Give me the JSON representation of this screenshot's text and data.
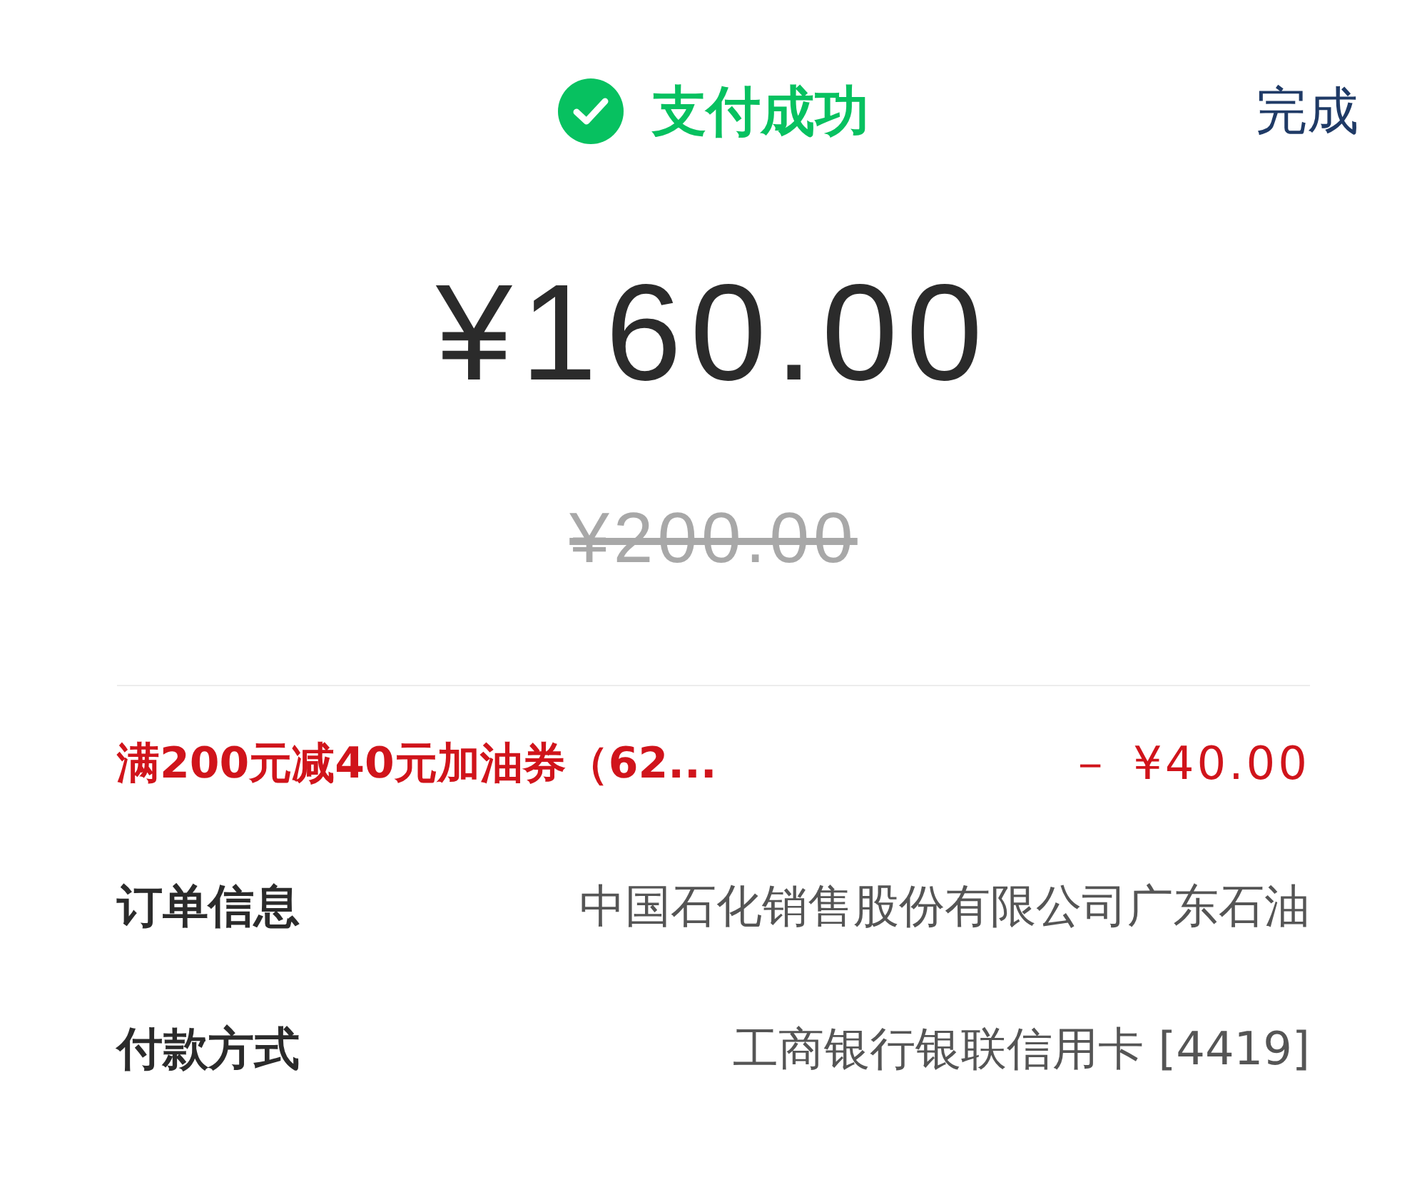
{
  "header": {
    "status": "支付成功",
    "done_button": "完成"
  },
  "amount": "¥160.00",
  "original_amount": "¥200.00",
  "details": [
    {
      "kind": "discount",
      "label": "满200元减40元加油券（62...",
      "value": "－ ¥40.00"
    },
    {
      "kind": "info",
      "label": "订单信息",
      "value": "中国石化销售股份有限公司广东石油"
    },
    {
      "kind": "info",
      "label": "付款方式",
      "value": "工商银行银联信用卡 [4419]"
    }
  ]
}
